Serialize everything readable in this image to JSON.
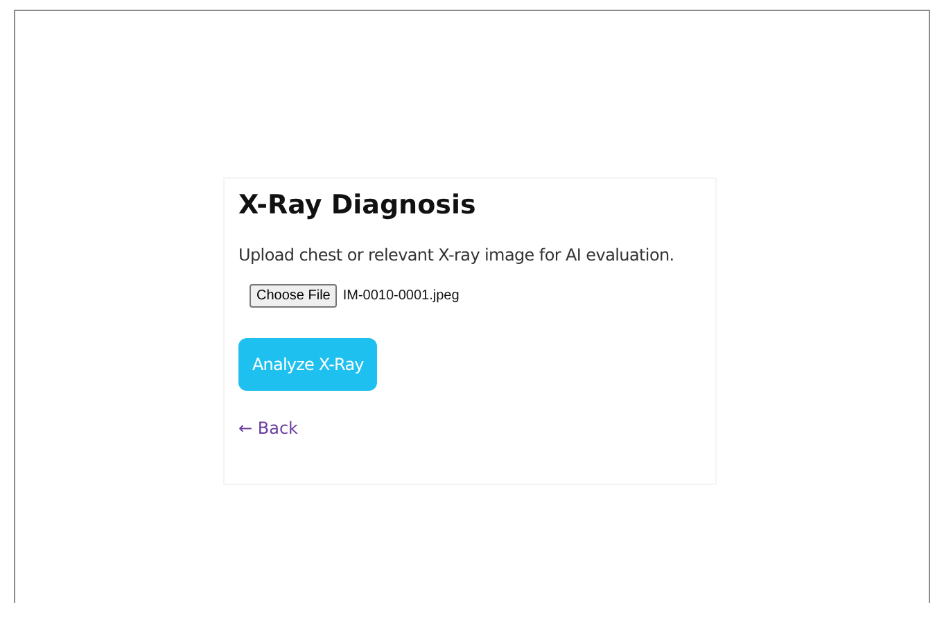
{
  "card": {
    "title": "X-Ray Diagnosis",
    "description": "Upload chest or relevant X-ray image for AI evaluation.",
    "file_input": {
      "button": "Choose File",
      "value": "IM-0010-0001.jpeg"
    },
    "analyze_button": "Analyze X-Ray",
    "back_link": "← Back"
  }
}
